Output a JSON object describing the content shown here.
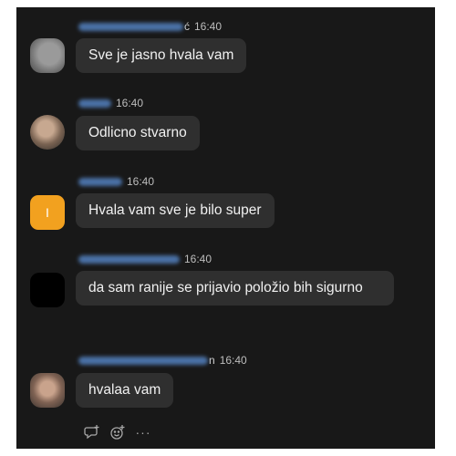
{
  "messages": [
    {
      "name_visible_tail": "ć",
      "time": "16:40",
      "text": "Sve je jasno hvala vam",
      "avatar_icon": "user-photo-avatar"
    },
    {
      "name_visible_tail": "",
      "time": "16:40",
      "text": "Odlicno stvarno",
      "avatar_icon": "user-photo-avatar"
    },
    {
      "name_visible_tail": "",
      "time": "16:40",
      "text": "Hvala vam sve je bilo super",
      "avatar_initial": "I",
      "avatar_color": "#f2a11f"
    },
    {
      "name_visible_tail": "",
      "time": "16:40",
      "text": "da sam ranije se prijavio položio bih sigurno",
      "avatar_icon": "user-photo-avatar"
    },
    {
      "name_visible_tail": "n",
      "time": "16:40",
      "text": "hvalaa vam",
      "avatar_icon": "user-photo-avatar"
    }
  ],
  "actions": {
    "reply_icon": "reply-icon",
    "reaction_icon": "add-reaction-icon",
    "more_label": "···"
  },
  "colors": {
    "background": "#181818",
    "bubble": "#2f2f2f",
    "text": "#f1f1f1",
    "name_blur": "#5b8fd6"
  }
}
